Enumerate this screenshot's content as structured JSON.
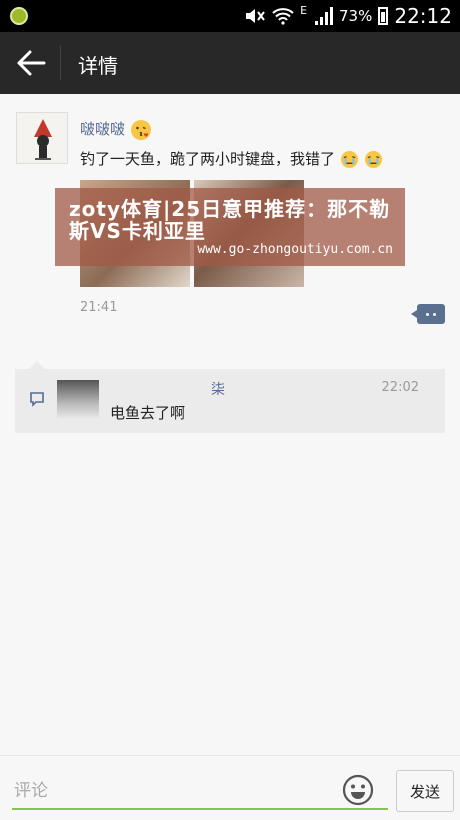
{
  "status_bar": {
    "battery": "73%",
    "network": "E",
    "time": "22:12"
  },
  "toolbar": {
    "title": "详情"
  },
  "post": {
    "author": "啵啵啵",
    "text": "钓了一天鱼，跪了两小时键盘，我错了",
    "time": "21:41",
    "photo_count": 2
  },
  "ad_banner": {
    "title": "zoty体育|25日意甲推荐：那不勒斯VS卡利亚里",
    "url": "www.go-zhongoutiyu.com.cn"
  },
  "comments": [
    {
      "name": "柒",
      "time": "22:02",
      "text": "电鱼去了啊"
    }
  ],
  "input": {
    "placeholder": "评论",
    "value": ""
  },
  "actions": {
    "send_label": "发送"
  },
  "colors": {
    "toolbar": "#282828",
    "link": "#576b95",
    "accent": "#8bc34a",
    "comment_bg": "#ebebeb"
  }
}
